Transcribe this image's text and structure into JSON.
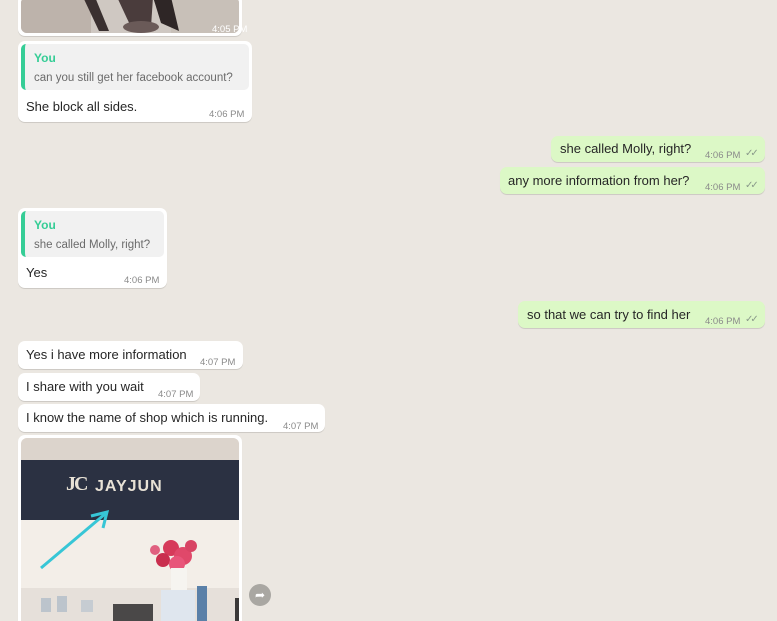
{
  "messages": {
    "img_top": {
      "time": "4:05 PM"
    },
    "m1": {
      "quote_author": "You",
      "quote_text": "can you still get her facebook account?",
      "text": "She block all sides.",
      "time": "4:06 PM"
    },
    "m2": {
      "text": "she called Molly, right?",
      "time": "4:06 PM"
    },
    "m3": {
      "text": "any more information from her?",
      "time": "4:06 PM"
    },
    "m4": {
      "quote_author": "You",
      "quote_text": "she called Molly, right?",
      "text": "Yes",
      "time": "4:06 PM"
    },
    "m5": {
      "text": "so that we can try to find her",
      "time": "4:06 PM"
    },
    "m6": {
      "text": "Yes i have more information",
      "time": "4:07 PM"
    },
    "m7": {
      "text": "I share with you wait",
      "time": "4:07 PM"
    },
    "m8": {
      "text": "I know the name of shop which is running.",
      "time": "4:07 PM"
    },
    "img_bottom": {
      "sign_brand": "JAYJUN",
      "sign_logo": "JC"
    }
  },
  "icons": {
    "read_receipt": "double-check-icon",
    "forward": "forward-icon"
  },
  "colors": {
    "background": "#ebe7e1",
    "incoming": "#ffffff",
    "outgoing": "#dcf8c6",
    "quote_accent": "#35cd96"
  }
}
